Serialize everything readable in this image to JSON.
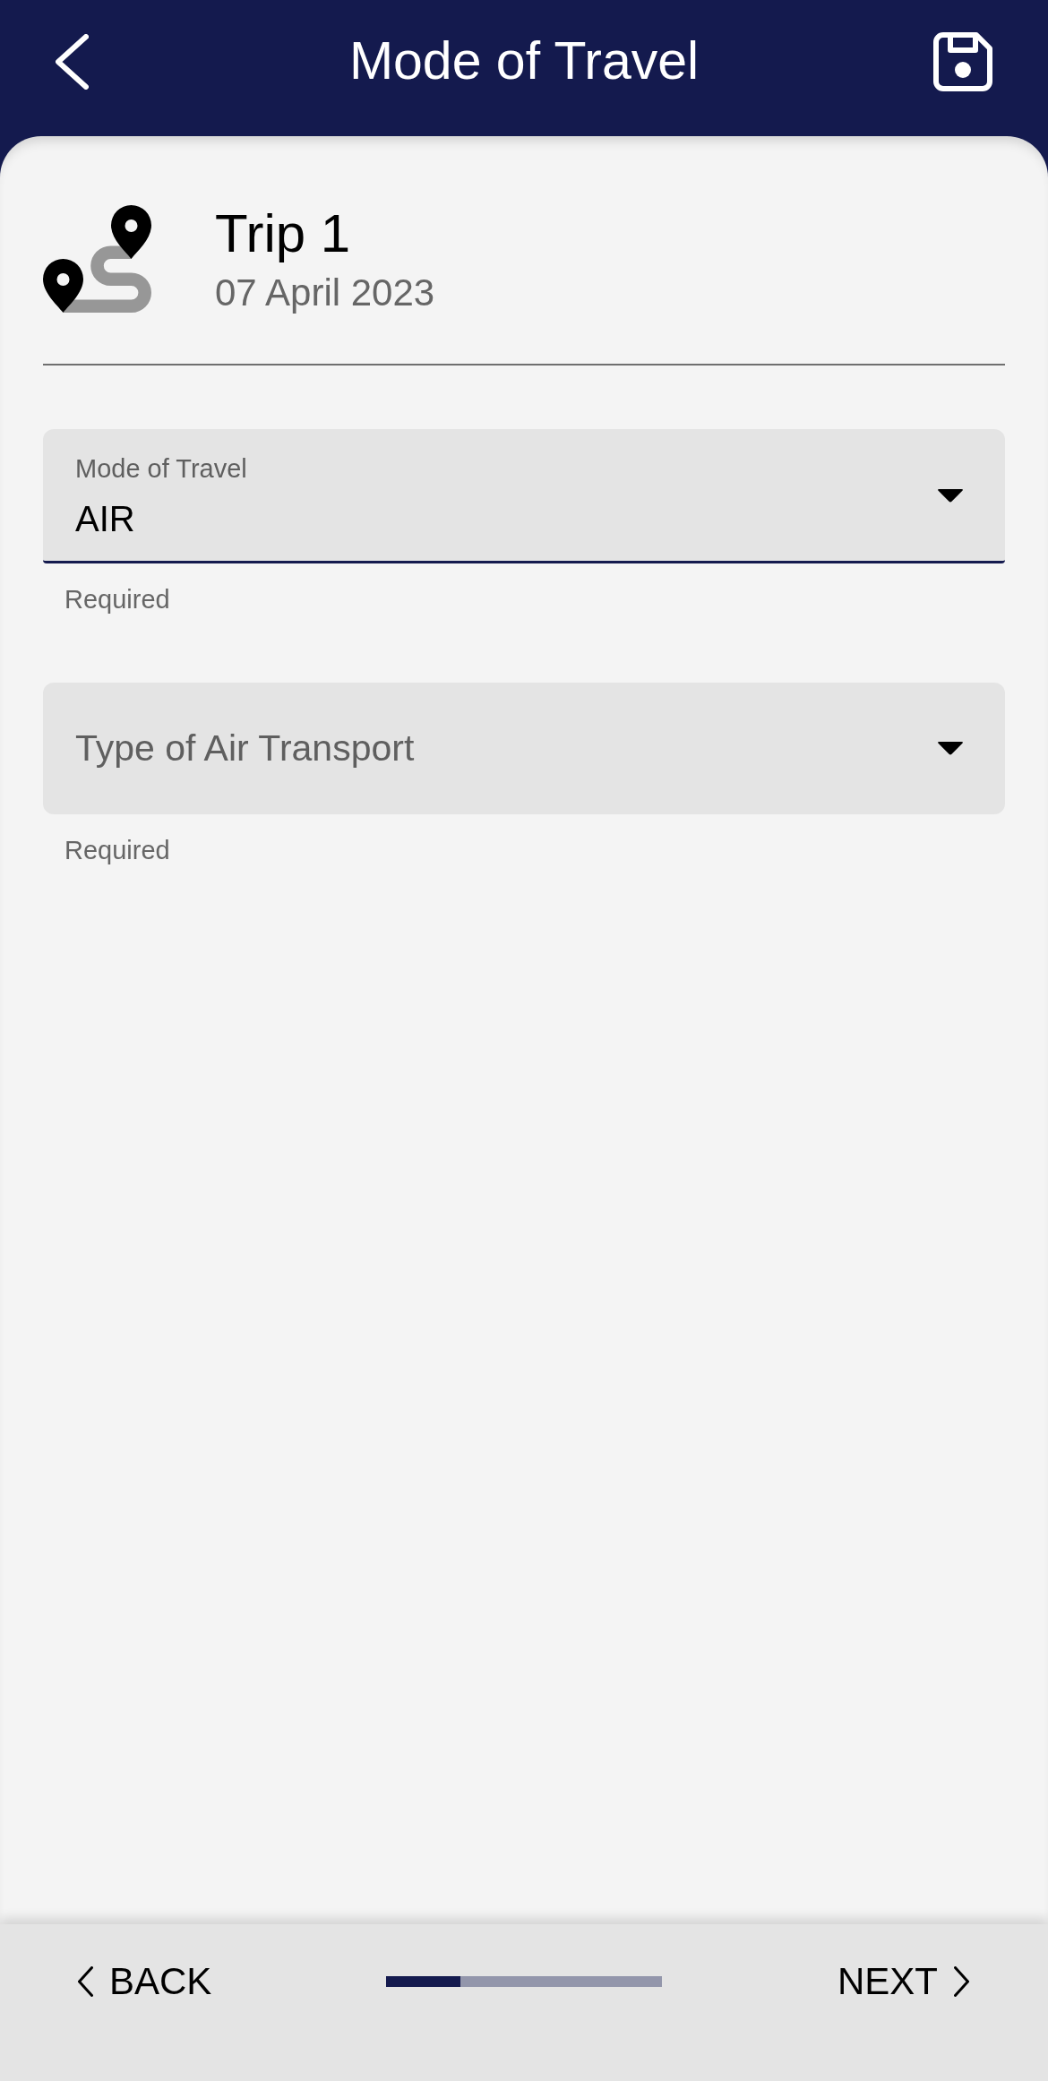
{
  "header": {
    "title": "Mode of Travel"
  },
  "trip": {
    "title": "Trip 1",
    "date": "07 April 2023"
  },
  "fields": [
    {
      "label": "Mode of Travel",
      "value": "AIR",
      "focused": true,
      "helper": "Required"
    },
    {
      "placeholder": "Type of Air Transport",
      "focused": false,
      "helper": "Required"
    }
  ],
  "footer": {
    "back": "BACK",
    "progress": {
      "level": 0.27
    },
    "next": "NEXT"
  }
}
